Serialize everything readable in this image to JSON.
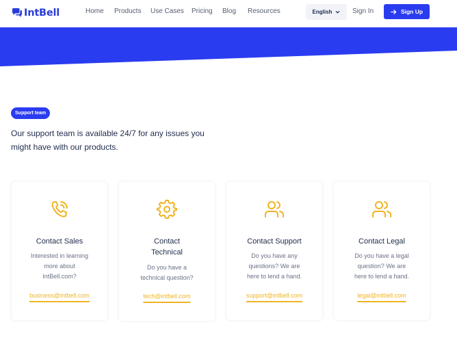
{
  "brand": {
    "name": "IntBell",
    "color": "#2a3cd8"
  },
  "nav": {
    "items": [
      "Home",
      "Products",
      "Use Cases",
      "Pricing",
      "Blog",
      "Resources"
    ]
  },
  "header": {
    "language": "English",
    "sign_in": "Sign In",
    "sign_up": "Sign Up"
  },
  "support": {
    "badge": "Support team",
    "intro": "Our support team is available 24/7 for any issues you might have with our products."
  },
  "cards": [
    {
      "icon": "phone-icon",
      "title": "Contact Sales",
      "description": "Interested in learning more about IntBell.com?",
      "email": "business@intbell.com"
    },
    {
      "icon": "gear-icon",
      "title": "Contact Technical",
      "description": "Do you have a technical question?",
      "email": "tech@intbell.com"
    },
    {
      "icon": "users-icon",
      "title": "Contact Support",
      "description": "Do you have any questions? We are here to lend a hand.",
      "email": "support@intbell.com"
    },
    {
      "icon": "users-icon",
      "title": "Contact Legal",
      "description": "Do you have a legal question? We are here to lend a hand.",
      "email": "legal@intbell.com"
    }
  ],
  "colors": {
    "primary": "#2a3cf0",
    "accent": "#f0b323",
    "text": "#1e2a4a",
    "muted": "#6a7186"
  }
}
